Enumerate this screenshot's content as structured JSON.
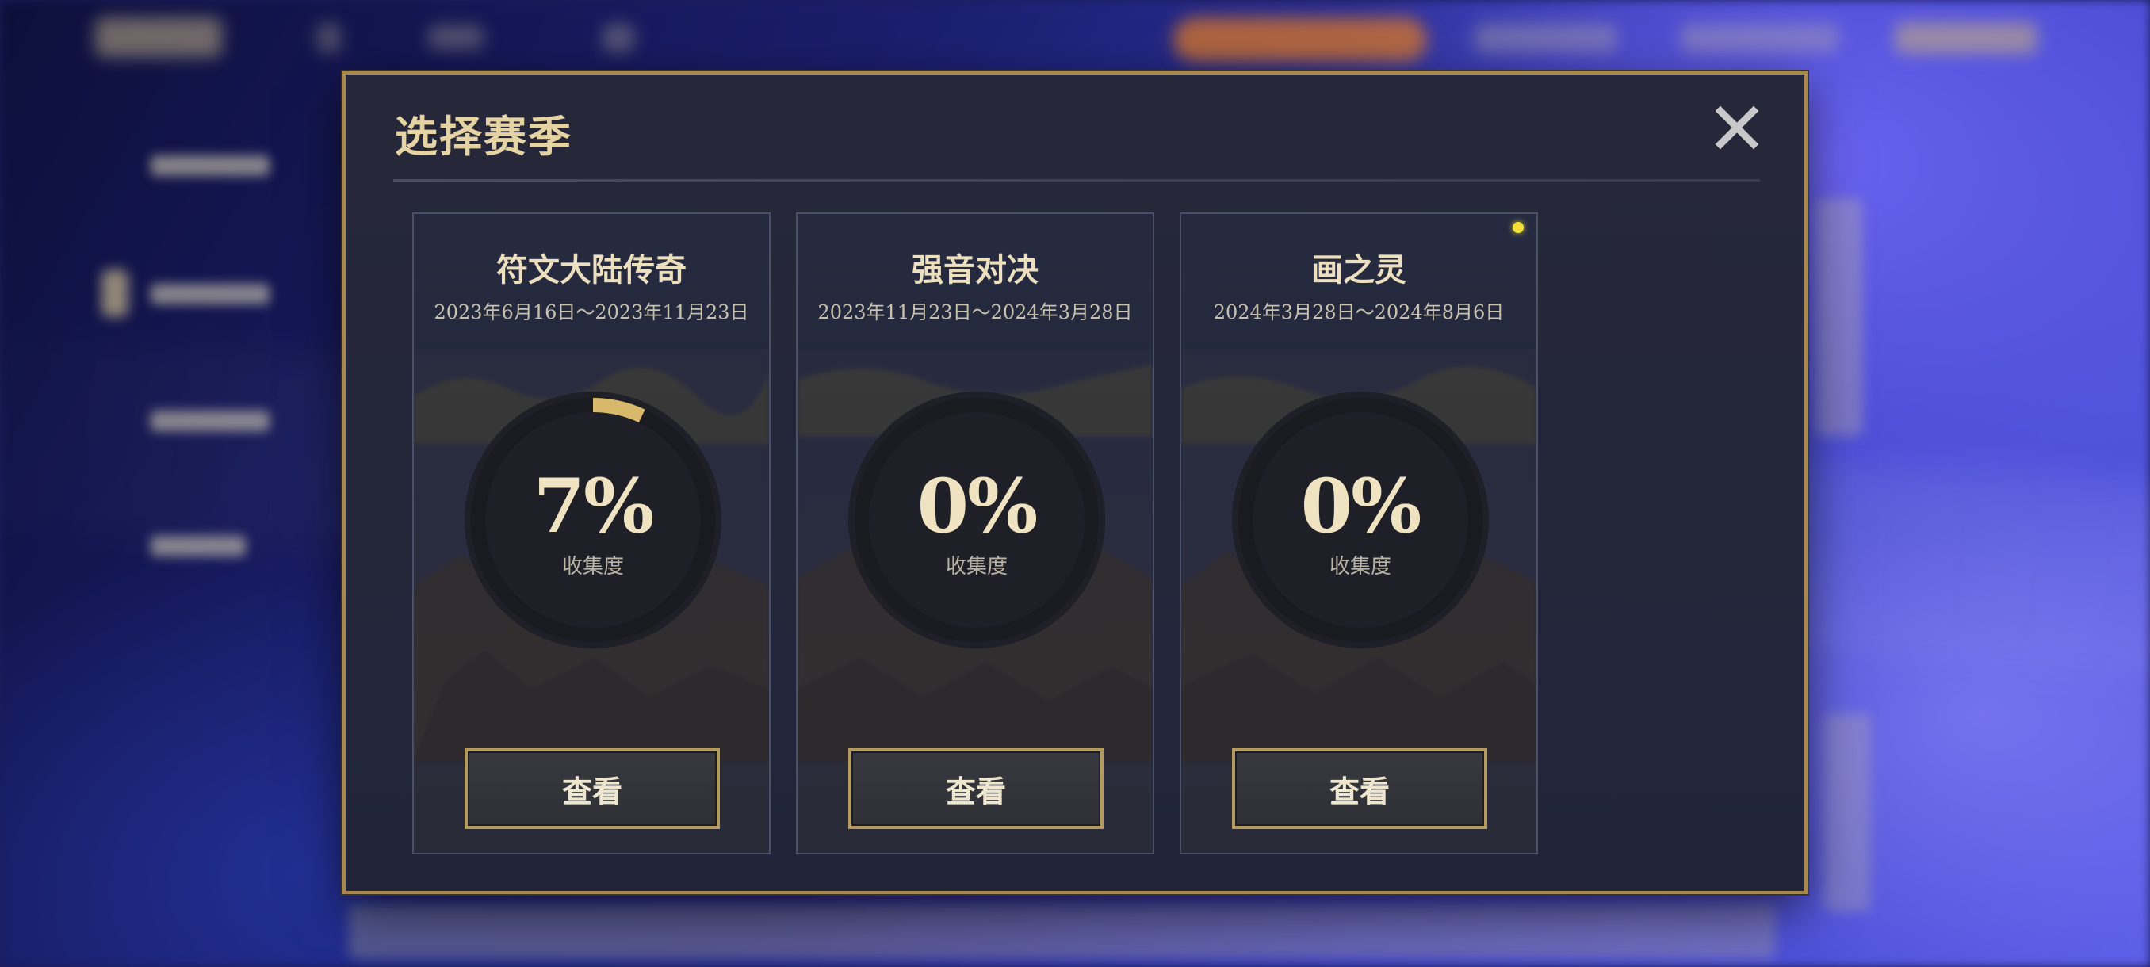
{
  "dialog": {
    "title": "选择赛季",
    "close_icon": "close-icon"
  },
  "seasons": [
    {
      "name": "符文大陆传奇",
      "dates": "2023年6月16日～2023年11月23日",
      "percent_text": "7%",
      "progress": 0.07,
      "collect_label": "收集度",
      "button_label": "查看",
      "new_dot": false
    },
    {
      "name": "强音对决",
      "dates": "2023年11月23日～2024年3月28日",
      "percent_text": "0%",
      "progress": 0.0,
      "collect_label": "收集度",
      "button_label": "查看",
      "new_dot": false
    },
    {
      "name": "画之灵",
      "dates": "2024年3月28日～2024年8月6日",
      "percent_text": "0%",
      "progress": 0.0,
      "collect_label": "收集度",
      "button_label": "查看",
      "new_dot": true
    }
  ],
  "colors": {
    "accent_gold": "#a8884c",
    "ring_progress": "#d8b86a",
    "ring_track": "#1c1c24",
    "new_dot": "#f3e13a"
  }
}
